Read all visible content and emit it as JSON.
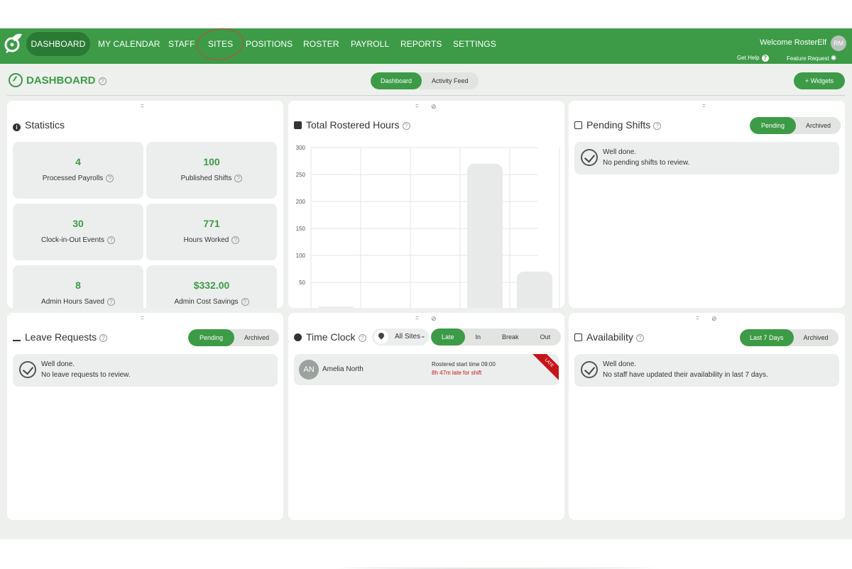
{
  "nav": {
    "items": [
      "DASHBOARD",
      "MY CALENDAR",
      "STAFF",
      "SITES",
      "POSITIONS",
      "ROSTER",
      "PAYROLL",
      "REPORTS",
      "SETTINGS"
    ],
    "welcome": "Welcome RosterElf",
    "avatar_initials": "RM",
    "get_help": "Get Help",
    "feature_request": "Feature Request"
  },
  "page": {
    "title": "DASHBOARD",
    "tabs": [
      "Dashboard",
      "Activity Feed"
    ],
    "widgets_button": "+ Widgets"
  },
  "statistics": {
    "title": "Statistics",
    "items": [
      {
        "value": "4",
        "label": "Processed Payrolls"
      },
      {
        "value": "100",
        "label": "Published Shifts"
      },
      {
        "value": "30",
        "label": "Clock-in-Out Events"
      },
      {
        "value": "771",
        "label": "Hours Worked"
      },
      {
        "value": "8",
        "label": "Admin Hours Saved"
      },
      {
        "value": "$332.00",
        "label": "Admin Cost Savings"
      }
    ]
  },
  "rostered_hours": {
    "title": "Total Rostered Hours"
  },
  "chart_data": {
    "type": "bar",
    "title": "Total Rostered Hours",
    "yticks": [
      "300",
      "250",
      "200",
      "150",
      "100",
      "50"
    ],
    "ylim": [
      0,
      300
    ],
    "values": [
      5,
      2,
      1,
      270,
      70
    ],
    "grid": true
  },
  "pending_shifts": {
    "title": "Pending Shifts",
    "toggle": [
      "Pending",
      "Archived"
    ],
    "msg1": "Well done.",
    "msg2": "No pending shifts to review."
  },
  "leave_requests": {
    "title": "Leave Requests",
    "toggle": [
      "Pending",
      "Archived"
    ],
    "msg1": "Well done.",
    "msg2": "No leave requests to review."
  },
  "time_clock": {
    "title": "Time Clock",
    "site_select": "All Sites",
    "tabs": [
      "Late",
      "In",
      "Break",
      "Out"
    ],
    "entry": {
      "initials": "AN",
      "name": "Amelia North",
      "rostered": "Rostered start time 09:00",
      "late_text": "8h 47m late for shift",
      "ribbon": "LATE"
    }
  },
  "availability": {
    "title": "Availability",
    "toggle": [
      "Last 7 Days",
      "Archived"
    ],
    "msg1": "Well done.",
    "msg2": "No staff have updated their availability in last 7 days."
  },
  "colors": {
    "brand_green": "#3d9b47",
    "dark_green": "#2b7a34",
    "late_red": "#c5151b"
  }
}
